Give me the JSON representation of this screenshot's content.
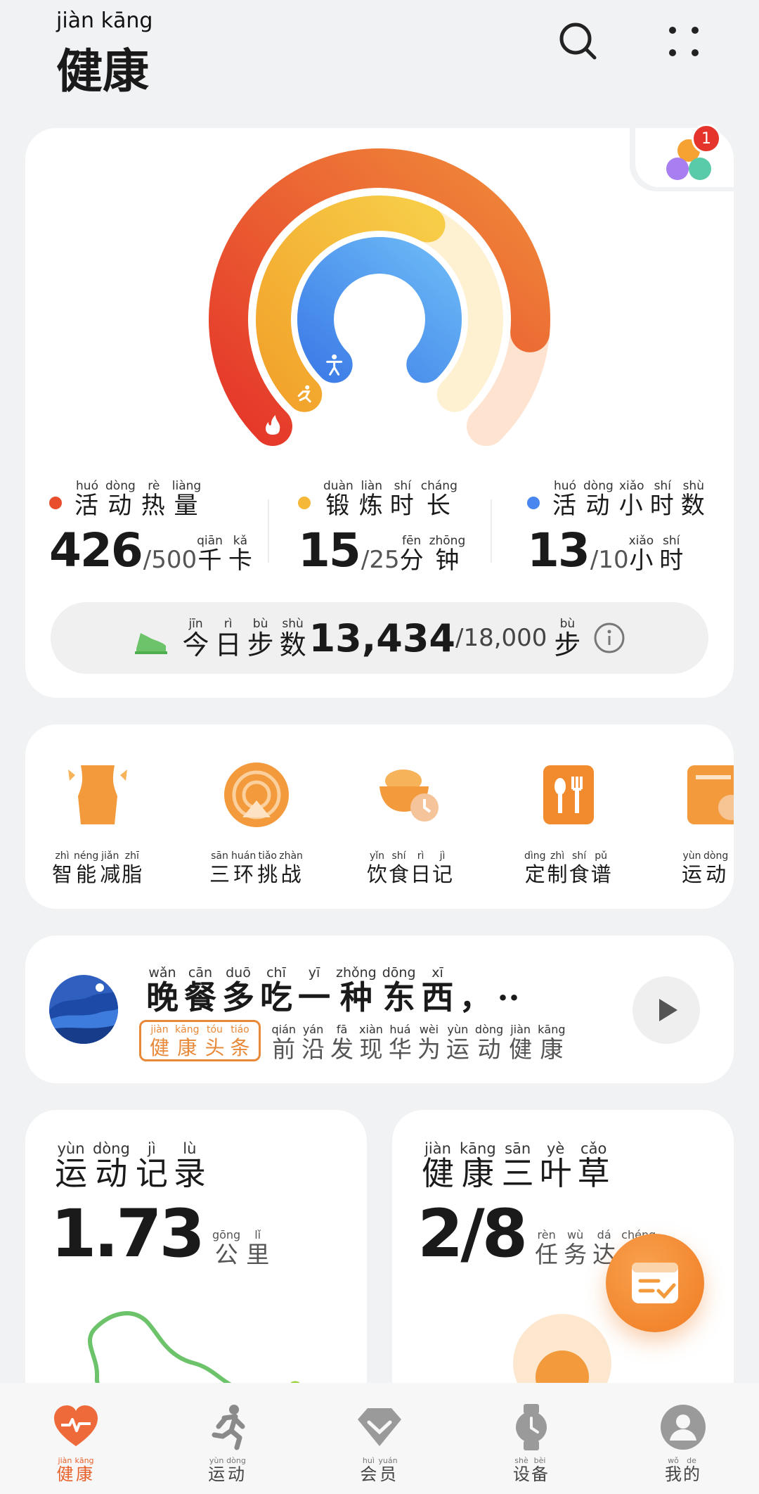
{
  "app": {
    "title": {
      "py": "jiàn kāng",
      "hz": "健康"
    }
  },
  "header": {
    "search_icon": "search-icon",
    "menu_icon": "grid-dots-icon"
  },
  "rings": {
    "notification_count": "1",
    "stats": [
      {
        "id": "calories",
        "color": "#e84e2c",
        "label": [
          {
            "py": "huó",
            "hz": "活"
          },
          {
            "py": "dòng",
            "hz": "动"
          },
          {
            "py": "rè",
            "hz": "热"
          },
          {
            "py": "liàng",
            "hz": "量"
          }
        ],
        "value": "426",
        "goal": "/500",
        "unit": [
          {
            "py": "qiān",
            "hz": "千"
          },
          {
            "py": "kǎ",
            "hz": "卡"
          }
        ]
      },
      {
        "id": "exercise",
        "color": "#f5b839",
        "label": [
          {
            "py": "duàn",
            "hz": "锻"
          },
          {
            "py": "liàn",
            "hz": "炼"
          },
          {
            "py": "shí",
            "hz": "时"
          },
          {
            "py": "cháng",
            "hz": "长"
          }
        ],
        "value": "15",
        "goal": "/25",
        "unit": [
          {
            "py": "fēn",
            "hz": "分"
          },
          {
            "py": "zhōng",
            "hz": "钟"
          }
        ]
      },
      {
        "id": "active-hours",
        "color": "#4a86f0",
        "label": [
          {
            "py": "huó",
            "hz": "活"
          },
          {
            "py": "dòng",
            "hz": "动"
          },
          {
            "py": "xiǎo",
            "hz": "小"
          },
          {
            "py": "shí",
            "hz": "时"
          },
          {
            "py": "shù",
            "hz": "数"
          }
        ],
        "value": "13",
        "goal": "/10",
        "unit": [
          {
            "py": "xiǎo",
            "hz": "小"
          },
          {
            "py": "shí",
            "hz": "时"
          }
        ]
      }
    ],
    "progress": {
      "calories": 0.852,
      "exercise": 0.6,
      "active_hours": 1.0
    },
    "steps": {
      "label": [
        {
          "py": "jīn",
          "hz": "今"
        },
        {
          "py": "rì",
          "hz": "日"
        },
        {
          "py": "bù",
          "hz": "步"
        },
        {
          "py": "shù",
          "hz": "数"
        }
      ],
      "value": "13,434",
      "goal": "/18,000",
      "unit": {
        "py": "bù",
        "hz": "步"
      }
    }
  },
  "shortcuts": [
    {
      "name": "smart-fat-loss",
      "label": [
        {
          "py": "zhì",
          "hz": "智"
        },
        {
          "py": "néng",
          "hz": "能"
        },
        {
          "py": "jiǎn",
          "hz": "减"
        },
        {
          "py": "zhī",
          "hz": "脂"
        }
      ]
    },
    {
      "name": "three-rings-challenge",
      "label": [
        {
          "py": "sān",
          "hz": "三"
        },
        {
          "py": "huán",
          "hz": "环"
        },
        {
          "py": "tiǎo",
          "hz": "挑"
        },
        {
          "py": "zhàn",
          "hz": "战"
        }
      ]
    },
    {
      "name": "diet-diary",
      "label": [
        {
          "py": "yǐn",
          "hz": "饮"
        },
        {
          "py": "shí",
          "hz": "食"
        },
        {
          "py": "rì",
          "hz": "日"
        },
        {
          "py": "jì",
          "hz": "记"
        }
      ]
    },
    {
      "name": "custom-recipe",
      "label": [
        {
          "py": "dìng",
          "hz": "定"
        },
        {
          "py": "zhì",
          "hz": "制"
        },
        {
          "py": "shí",
          "hz": "食"
        },
        {
          "py": "pǔ",
          "hz": "谱"
        }
      ]
    },
    {
      "name": "sport",
      "label": [
        {
          "py": "yùn",
          "hz": "运"
        },
        {
          "py": "dòng",
          "hz": "动"
        }
      ]
    }
  ],
  "article": {
    "title": [
      {
        "py": "wǎn",
        "hz": "晚"
      },
      {
        "py": "cān",
        "hz": "餐"
      },
      {
        "py": "duō",
        "hz": "多"
      },
      {
        "py": "chī",
        "hz": "吃"
      },
      {
        "py": "yī",
        "hz": "一"
      },
      {
        "py": "zhǒng",
        "hz": "种"
      },
      {
        "py": "dōng",
        "hz": "东"
      },
      {
        "py": "xī",
        "hz": "西"
      },
      {
        "py": "",
        "hz": "，"
      },
      {
        "py": "",
        "hz": "··"
      }
    ],
    "tag": [
      {
        "py": "jiàn",
        "hz": "健"
      },
      {
        "py": "kāng",
        "hz": "康"
      },
      {
        "py": "tóu",
        "hz": "头"
      },
      {
        "py": "tiáo",
        "hz": "条"
      }
    ],
    "source": [
      {
        "py": "qián",
        "hz": "前"
      },
      {
        "py": "yán",
        "hz": "沿"
      },
      {
        "py": "fā",
        "hz": "发"
      },
      {
        "py": "xiàn",
        "hz": "现"
      },
      {
        "py": "huá",
        "hz": "华"
      },
      {
        "py": "wèi",
        "hz": "为"
      },
      {
        "py": "yùn",
        "hz": "运"
      },
      {
        "py": "dòng",
        "hz": "动"
      },
      {
        "py": "jiàn",
        "hz": "健"
      },
      {
        "py": "kāng",
        "hz": "康"
      }
    ]
  },
  "record": {
    "title": [
      {
        "py": "yùn",
        "hz": "运"
      },
      {
        "py": "dòng",
        "hz": "动"
      },
      {
        "py": "jì",
        "hz": "记"
      },
      {
        "py": "lù",
        "hz": "录"
      }
    ],
    "value": "1.73",
    "unit": [
      {
        "py": "gōng",
        "hz": "公"
      },
      {
        "py": "lǐ",
        "hz": "里"
      }
    ]
  },
  "herb": {
    "title": [
      {
        "py": "jiàn",
        "hz": "健"
      },
      {
        "py": "kāng",
        "hz": "康"
      },
      {
        "py": "sān",
        "hz": "三"
      },
      {
        "py": "yè",
        "hz": "叶"
      },
      {
        "py": "cǎo",
        "hz": "草"
      }
    ],
    "value": "2/8",
    "unit": [
      {
        "py": "rèn",
        "hz": "任"
      },
      {
        "py": "wù",
        "hz": "务"
      },
      {
        "py": "dá",
        "hz": "达"
      },
      {
        "py": "chéng",
        "hz": "成"
      }
    ]
  },
  "nav": [
    {
      "name": "health",
      "active": true,
      "label": [
        {
          "py": "jiàn",
          "hz": "健"
        },
        {
          "py": "kāng",
          "hz": "康"
        }
      ]
    },
    {
      "name": "exercise",
      "active": false,
      "label": [
        {
          "py": "yùn",
          "hz": "运"
        },
        {
          "py": "dòng",
          "hz": "动"
        }
      ]
    },
    {
      "name": "membership",
      "active": false,
      "label": [
        {
          "py": "huì",
          "hz": "会"
        },
        {
          "py": "yuán",
          "hz": "员"
        }
      ]
    },
    {
      "name": "devices",
      "active": false,
      "label": [
        {
          "py": "shè",
          "hz": "设"
        },
        {
          "py": "bèi",
          "hz": "备"
        }
      ]
    },
    {
      "name": "me",
      "active": false,
      "label": [
        {
          "py": "wǒ",
          "hz": "我"
        },
        {
          "py": "de",
          "hz": "的"
        }
      ]
    }
  ]
}
